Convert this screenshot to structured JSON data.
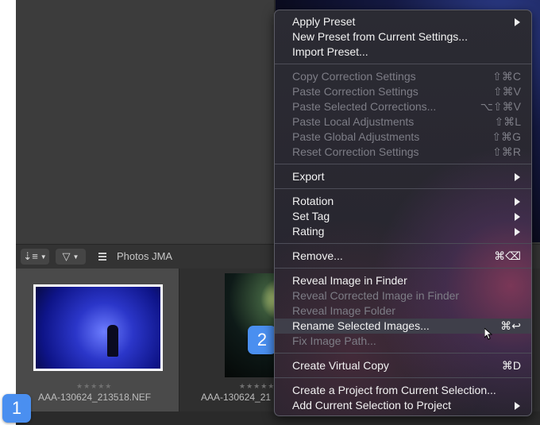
{
  "toolbar": {
    "sort_icon": "sort-icon",
    "filter_icon": "filter-icon",
    "title": "Photos JMA"
  },
  "filmstrip": {
    "items": [
      {
        "rating": "★★★★★",
        "label": "AAA-130624_213518.NEF"
      },
      {
        "rating": "★★★★★",
        "label": "AAA-130624_21"
      }
    ]
  },
  "badges": {
    "first": "1",
    "second": "2"
  },
  "menu": {
    "apply_preset": "Apply Preset",
    "new_preset": "New Preset from Current Settings...",
    "import_preset": "Import Preset...",
    "copy_correction": "Copy Correction Settings",
    "copy_correction_sc": "⇧⌘C",
    "paste_correction": "Paste Correction Settings",
    "paste_correction_sc": "⇧⌘V",
    "paste_selected": "Paste Selected Corrections...",
    "paste_selected_sc": "⌥⇧⌘V",
    "paste_local": "Paste Local Adjustments",
    "paste_local_sc": "⇧⌘L",
    "paste_global": "Paste Global Adjustments",
    "paste_global_sc": "⇧⌘G",
    "reset_correction": "Reset Correction Settings",
    "reset_correction_sc": "⇧⌘R",
    "export": "Export",
    "rotation": "Rotation",
    "set_tag": "Set Tag",
    "rating": "Rating",
    "remove": "Remove...",
    "remove_sc": "⌘⌫",
    "reveal_finder": "Reveal Image in Finder",
    "reveal_corrected": "Reveal Corrected Image in Finder",
    "reveal_folder": "Reveal Image Folder",
    "rename_selected": "Rename Selected Images...",
    "rename_selected_sc": "⌘↩",
    "fix_path": "Fix Image Path...",
    "create_virtual": "Create Virtual Copy",
    "create_virtual_sc": "⌘D",
    "create_project": "Create a Project from Current Selection...",
    "add_to_project": "Add Current Selection to Project"
  }
}
